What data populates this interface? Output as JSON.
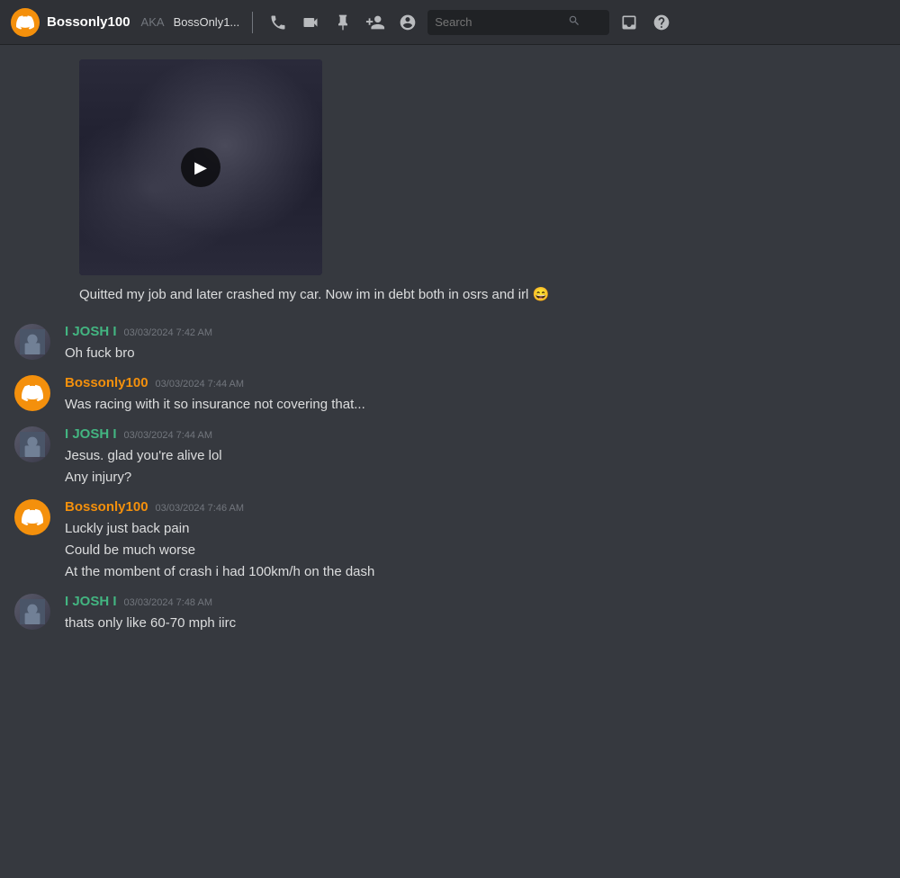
{
  "topbar": {
    "username": "Bossonly100",
    "aka_label": "AKA",
    "aka_name": "BossOnly1...",
    "search_placeholder": "Search"
  },
  "messages": [
    {
      "id": "msg-video",
      "type": "video",
      "has_video": true
    },
    {
      "id": "msg-standalone",
      "type": "standalone",
      "text": "Quitted my job and later crashed my car. Now im in debt both in osrs and irl 😄"
    },
    {
      "id": "msg-josh-1",
      "type": "full",
      "author": "I JOSH I",
      "author_class": "josh",
      "timestamp": "03/03/2024 7:42 AM",
      "avatar_type": "josh",
      "lines": [
        "Oh fuck bro"
      ]
    },
    {
      "id": "msg-boss-1",
      "type": "full",
      "author": "Bossonly100",
      "author_class": "bossonly",
      "timestamp": "03/03/2024 7:44 AM",
      "avatar_type": "discord",
      "lines": [
        "Was racing with it so insurance not covering that..."
      ]
    },
    {
      "id": "msg-josh-2",
      "type": "full",
      "author": "I JOSH I",
      "author_class": "josh",
      "timestamp": "03/03/2024 7:44 AM",
      "avatar_type": "josh",
      "lines": [
        "Jesus. glad you're alive lol",
        "Any injury?"
      ]
    },
    {
      "id": "msg-boss-2",
      "type": "full",
      "author": "Bossonly100",
      "author_class": "bossonly",
      "timestamp": "03/03/2024 7:46 AM",
      "avatar_type": "discord",
      "lines": [
        "Luckly just back pain",
        "Could be much worse",
        "At the mombent of crash i had 100km/h on the dash"
      ]
    },
    {
      "id": "msg-josh-3",
      "type": "full",
      "author": "I JOSH I",
      "author_class": "josh",
      "timestamp": "03/03/2024 7:48 AM",
      "avatar_type": "josh",
      "lines": [
        "thats only like 60-70 mph iirc"
      ]
    }
  ]
}
